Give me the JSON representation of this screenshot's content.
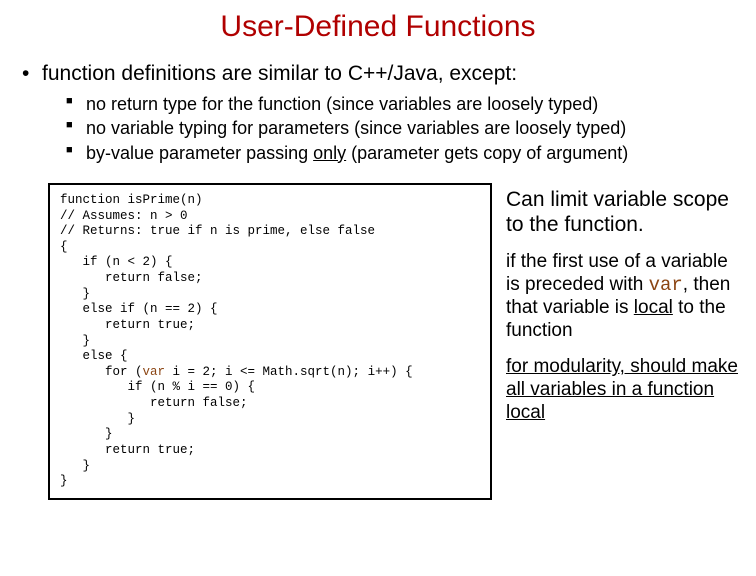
{
  "title": "User-Defined Functions",
  "top_bullet": "function definitions are similar to C++/Java, except:",
  "sub": {
    "a": "no return type for the function (since variables are loosely typed)",
    "b": "no variable typing for parameters (since variables are loosely typed)",
    "c_pre": "by-value parameter passing ",
    "c_u": "only",
    "c_post": " (parameter gets copy of argument)"
  },
  "code": {
    "l1": "function isPrime(n)",
    "l2": "// Assumes: n > 0",
    "l3": "// Returns: true if n is prime, else false",
    "l4": "{",
    "l5": "   if (n < 2) {",
    "l6": "      return false;",
    "l7": "   }",
    "l8": "   else if (n == 2) {",
    "l9": "      return true;",
    "l10": "   }",
    "l11": "   else {",
    "l12a": "      for (",
    "l12kw": "var",
    "l12b": " i = 2; i <= Math.sqrt(n); i++) {",
    "l13": "         if (n % i == 0) {",
    "l14": "            return false;",
    "l15": "         }",
    "l16": "      }",
    "l17": "      return true;",
    "l18": "   }",
    "l19": "}"
  },
  "right": {
    "lead": "Can limit variable scope to the function.",
    "p1a": "if the first use of a variable is preceded with ",
    "p1kw": "var",
    "p1b": ", then that variable is ",
    "p1u": "local",
    "p1c": " to the function",
    "p2": "for modularity, should make all variables in a function local"
  }
}
